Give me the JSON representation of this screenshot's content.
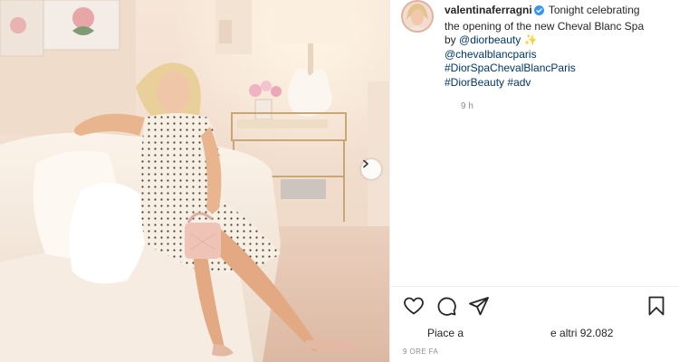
{
  "post": {
    "username": "valentinaferragni",
    "caption_pre": "Tonight celebrating the opening of the new Cheval Blanc Spa by ",
    "mention_dior": "@diorbeauty",
    "sparkle": "✨",
    "mention_cheval": "@chevalblancparis",
    "hashtag_spa": "#DiorSpaChevalBlancParis",
    "hashtag_beauty": "#DiorBeauty",
    "hashtag_adv": "#adv",
    "time_ago": "9 h",
    "likes_prefix": "Piace a",
    "likes_suffix": "e altri 92.082",
    "timestamp": "9 ORE FA"
  },
  "colors": {
    "link": "#00376b",
    "verified": "#3897f0",
    "muted": "#8e8e8e",
    "text": "#262626"
  },
  "icons": [
    "next-arrow-icon",
    "verified-badge-icon",
    "heart-icon",
    "comment-icon",
    "share-icon",
    "bookmark-icon"
  ]
}
